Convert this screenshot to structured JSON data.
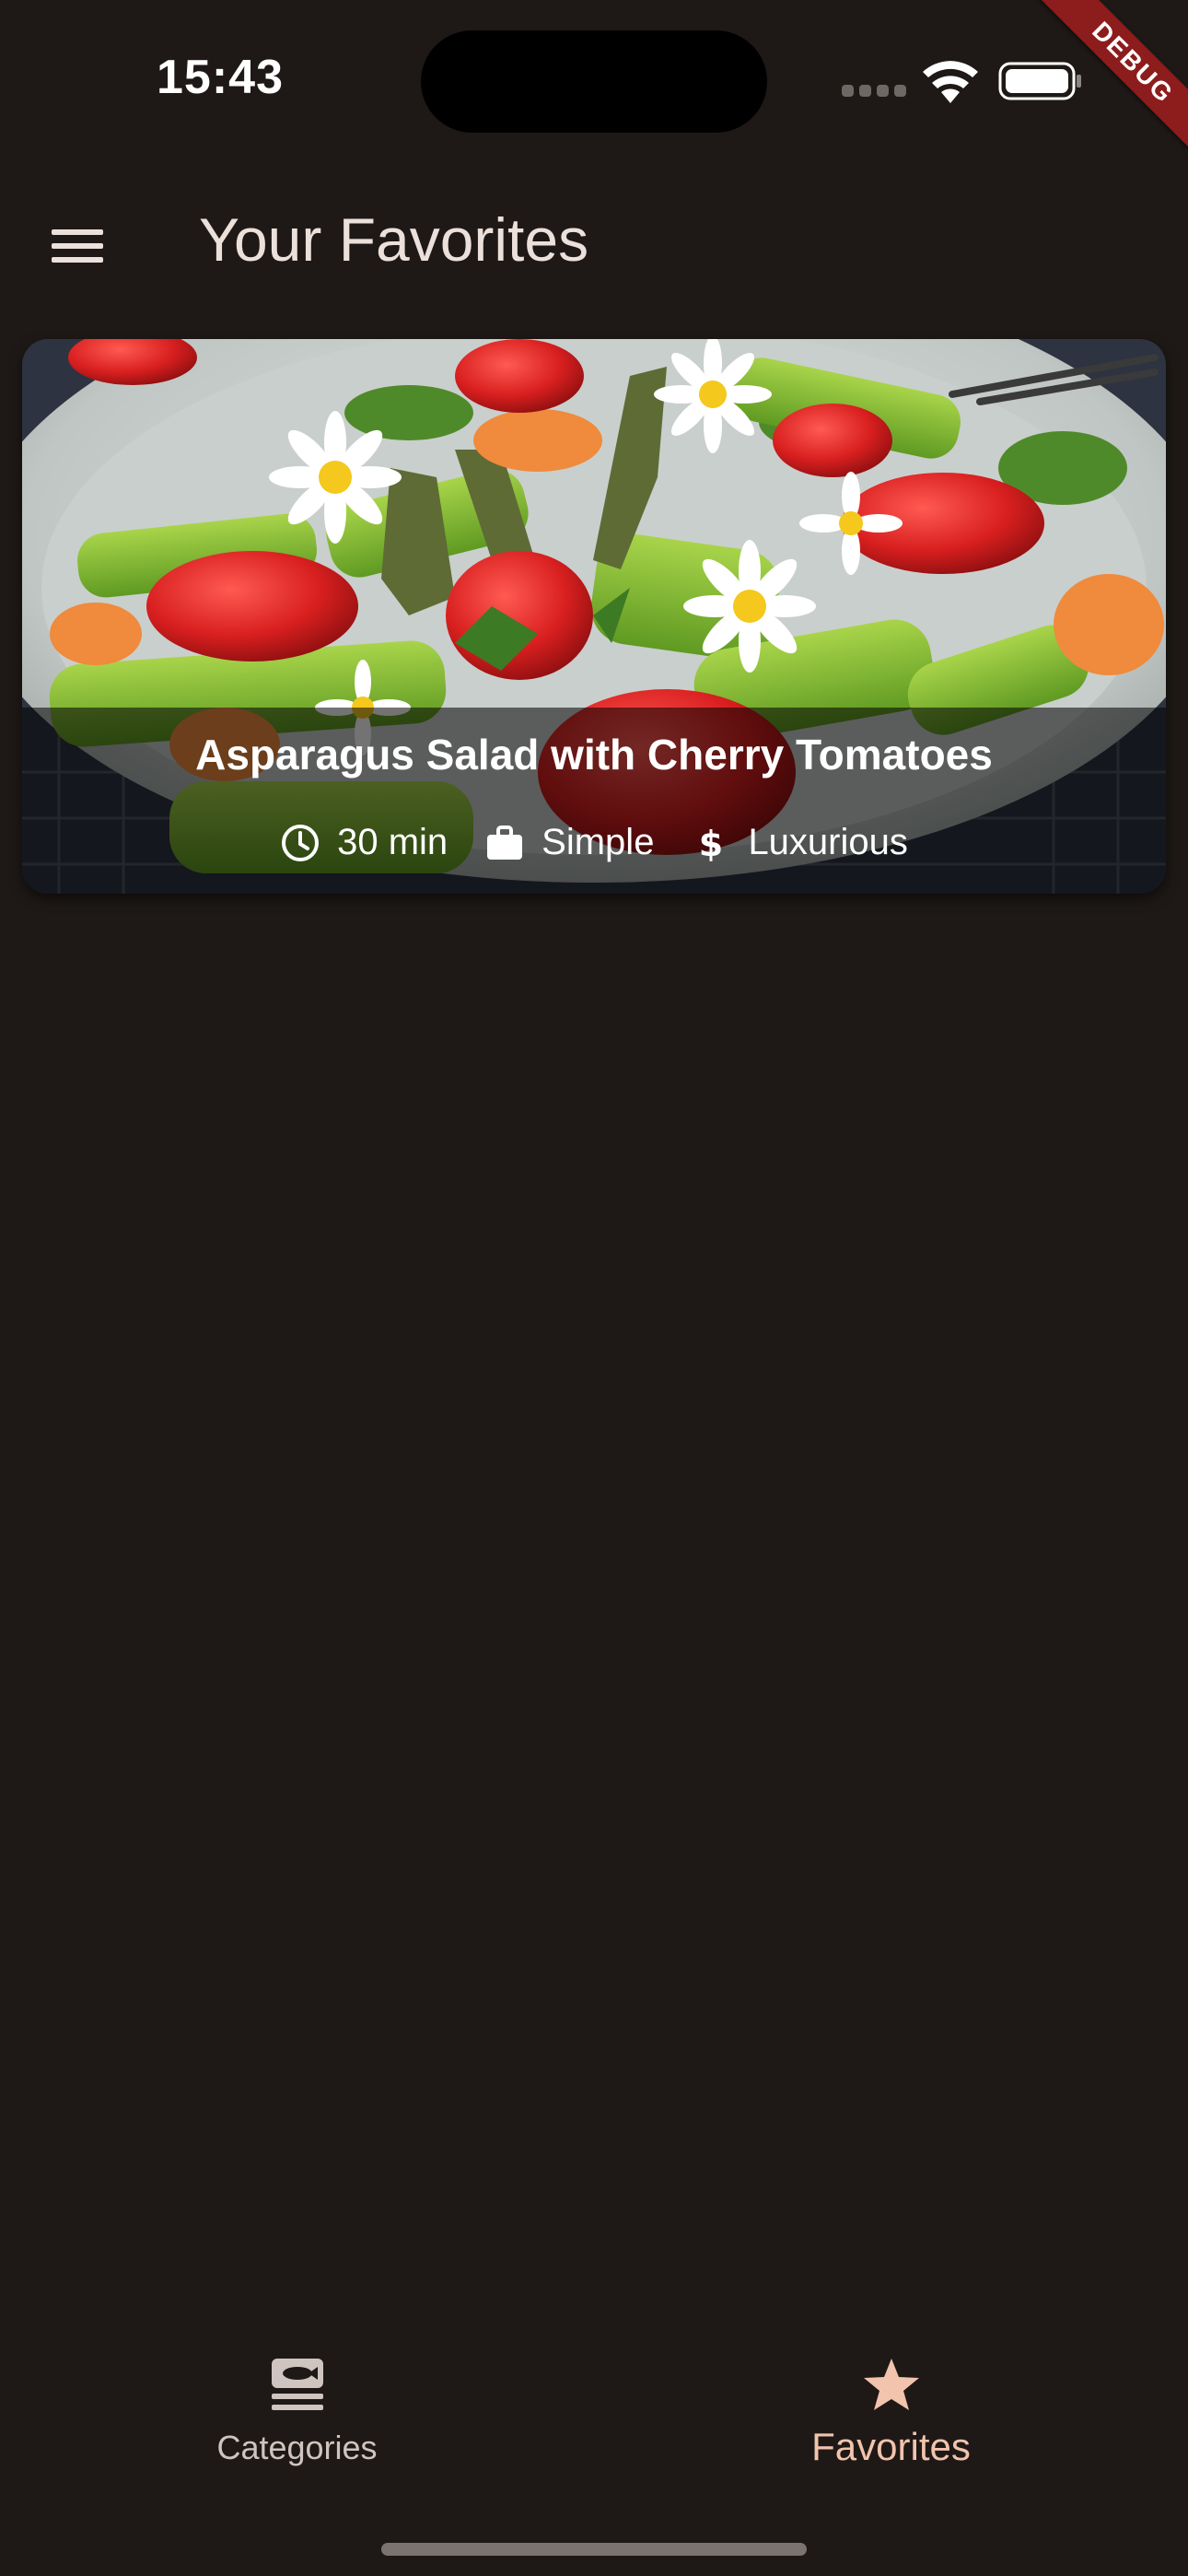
{
  "status_bar": {
    "time": "15:43"
  },
  "debug_banner": {
    "label": "DEBUG"
  },
  "app_bar": {
    "title": "Your Favorites",
    "menu_icon": "hamburger-menu-icon"
  },
  "favorites": [
    {
      "title": "Asparagus Salad with Cherry Tomatoes",
      "duration": "30 min",
      "complexity": "Simple",
      "affordability": "Luxurious",
      "icons": {
        "duration": "clock-icon",
        "complexity": "briefcase-icon",
        "affordability": "dollar-icon"
      }
    }
  ],
  "bottom_nav": {
    "items": [
      {
        "label": "Categories",
        "icon": "set-meal-icon",
        "selected": false
      },
      {
        "label": "Favorites",
        "icon": "star-icon",
        "selected": true
      }
    ]
  },
  "colors": {
    "background": "#1e1916",
    "text": "#ece0da",
    "accent": "#f2c3ad",
    "debug": "#8d1c1c"
  }
}
